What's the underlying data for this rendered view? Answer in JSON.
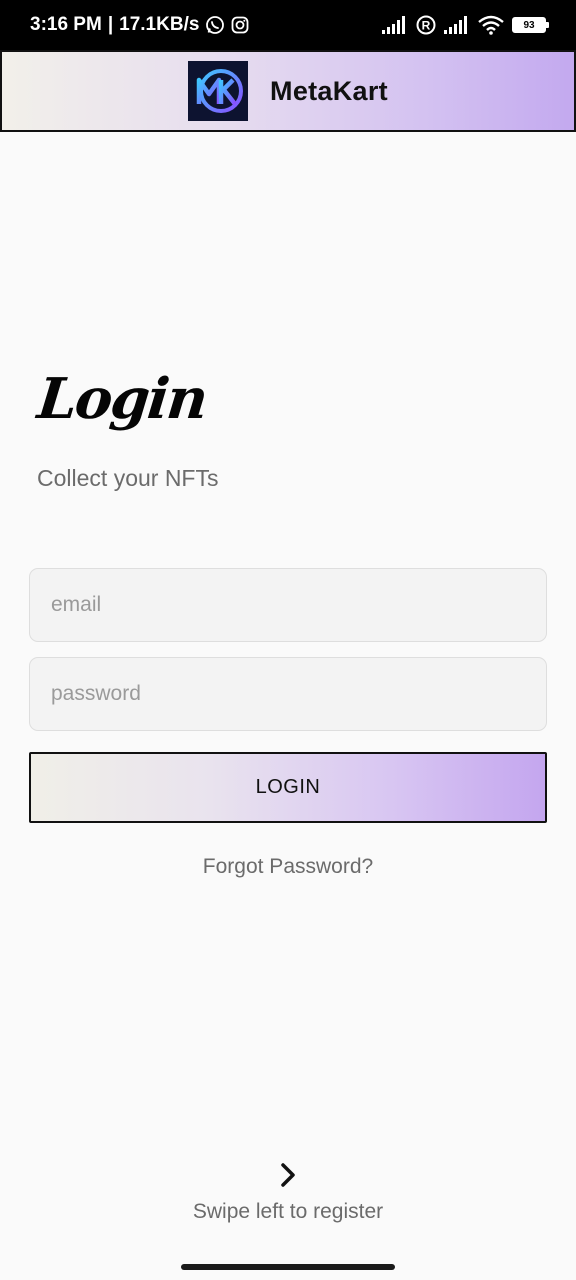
{
  "status_bar": {
    "time": "3:16 PM",
    "speed": "17.1KB/s",
    "battery_level": "93",
    "icons": [
      "whatsapp-icon",
      "instagram-icon",
      "signal-icon",
      "registered-icon",
      "signal-icon",
      "wifi-icon",
      "battery-icon"
    ]
  },
  "header": {
    "title": "MetaKart",
    "logo_text": "MK",
    "gradient_colors": [
      "#f2f0ea",
      "#c3a9ef"
    ]
  },
  "login": {
    "heading": "Login",
    "subtitle": "Collect your NFTs",
    "email_placeholder": "email",
    "email_value": "",
    "password_placeholder": "password",
    "password_value": "",
    "button_label": "LOGIN",
    "forgot_label": "Forgot Password?"
  },
  "footer": {
    "arrow_icon": "chevron-right-icon",
    "swipe_label": "Swipe left to register"
  }
}
